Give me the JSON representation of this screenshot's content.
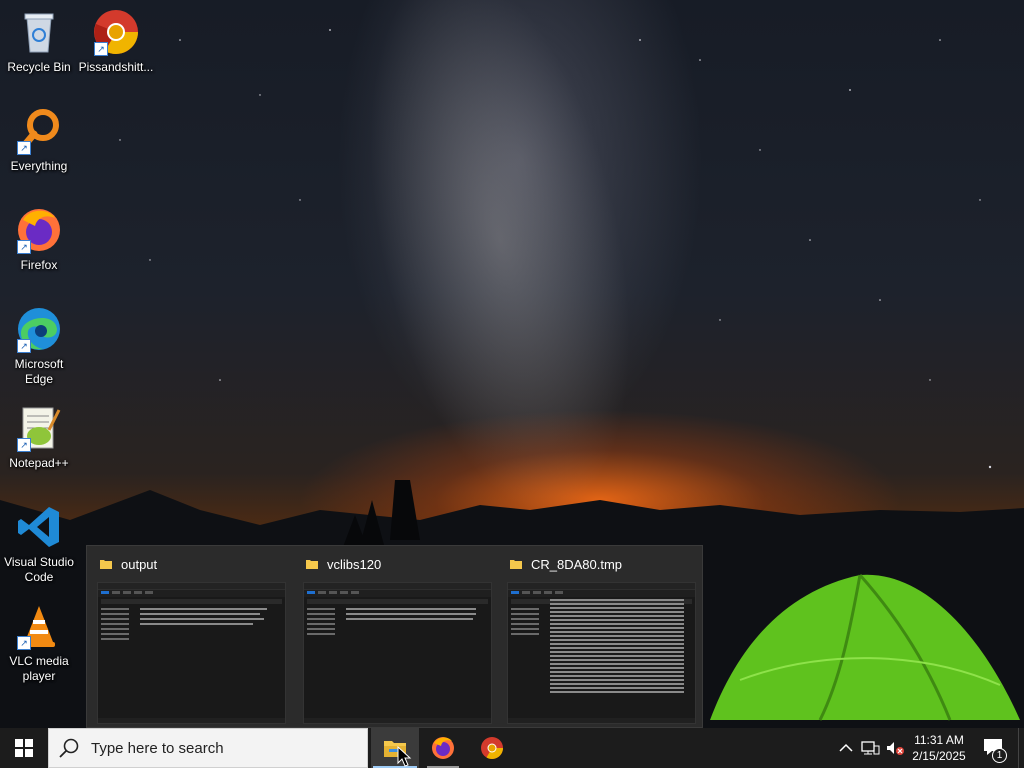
{
  "desktop": {
    "icons": [
      {
        "label": "Recycle Bin",
        "icon": "recycle-bin-icon"
      },
      {
        "label": "Pissandshitt...",
        "icon": "chrome-icon"
      },
      {
        "label": "Everything",
        "icon": "everything-search-icon"
      },
      {
        "label": "Firefox",
        "icon": "firefox-icon"
      },
      {
        "label": "Microsoft Edge",
        "icon": "edge-icon"
      },
      {
        "label": "Notepad++",
        "icon": "notepadpp-icon"
      },
      {
        "label": "Visual Studio Code",
        "icon": "vscode-icon"
      },
      {
        "label": "VLC media player",
        "icon": "vlc-icon"
      }
    ]
  },
  "flyout": {
    "windows": [
      {
        "title": "output"
      },
      {
        "title": "vclibs120"
      },
      {
        "title": "CR_8DA80.tmp"
      }
    ]
  },
  "taskbar": {
    "search_placeholder": "Type here to search",
    "apps": [
      "file-explorer-icon",
      "firefox-icon",
      "chrome-icon"
    ],
    "clock": {
      "time": "11:31 AM",
      "date": "2/15/2025"
    },
    "notification_count": "1"
  },
  "colors": {
    "taskbar_bg": "#1c1c1c",
    "accent": "#9ecbf5",
    "flyout_bg": "#2b2b2b"
  }
}
